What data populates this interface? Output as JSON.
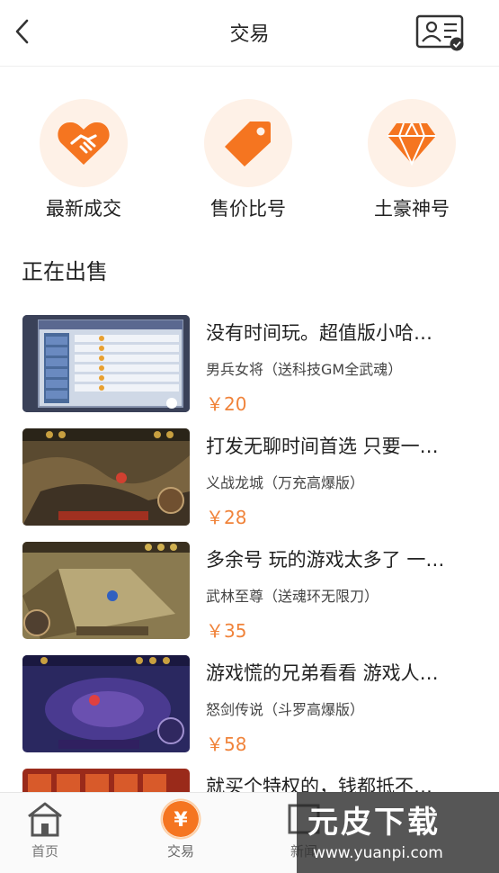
{
  "header": {
    "title": "交易",
    "back_icon": "chevron-left-icon",
    "profile_icon": "id-card-icon"
  },
  "categories": [
    {
      "label": "最新成交",
      "icon": "handshake-icon"
    },
    {
      "label": "售价比号",
      "icon": "price-tag-icon"
    },
    {
      "label": "土豪神号",
      "icon": "diamond-icon"
    }
  ],
  "section_title": "正在出售",
  "listings": [
    {
      "title": "没有时间玩。超值版小哈…",
      "subtitle": "男兵女将（送科技GM全武魂）",
      "price": "￥20"
    },
    {
      "title": "打发无聊时间首选 只要一…",
      "subtitle": "义战龙城（万充高爆版）",
      "price": "￥28"
    },
    {
      "title": "多余号 玩的游戏太多了 一…",
      "subtitle": "武林至尊（送魂环无限刀）",
      "price": "￥35"
    },
    {
      "title": "游戏慌的兄弟看看 游戏人…",
      "subtitle": "怒剑传说（斗罗高爆版）",
      "price": "￥58"
    },
    {
      "title": "就买个特权的，钱都抵不…",
      "subtitle": "",
      "price": ""
    }
  ],
  "tabbar": {
    "items": [
      {
        "label": "首页",
        "icon": "home-icon"
      },
      {
        "label": "交易",
        "icon": "yen-coin-icon"
      },
      {
        "label": "新闻",
        "icon": "news-icon"
      }
    ]
  },
  "watermark": {
    "logo": "元皮下载",
    "url": "www.yuanpi.com"
  },
  "colors": {
    "accent": "#f0833a",
    "icon_orange": "#f57520",
    "icon_bg": "#fef1e7"
  }
}
